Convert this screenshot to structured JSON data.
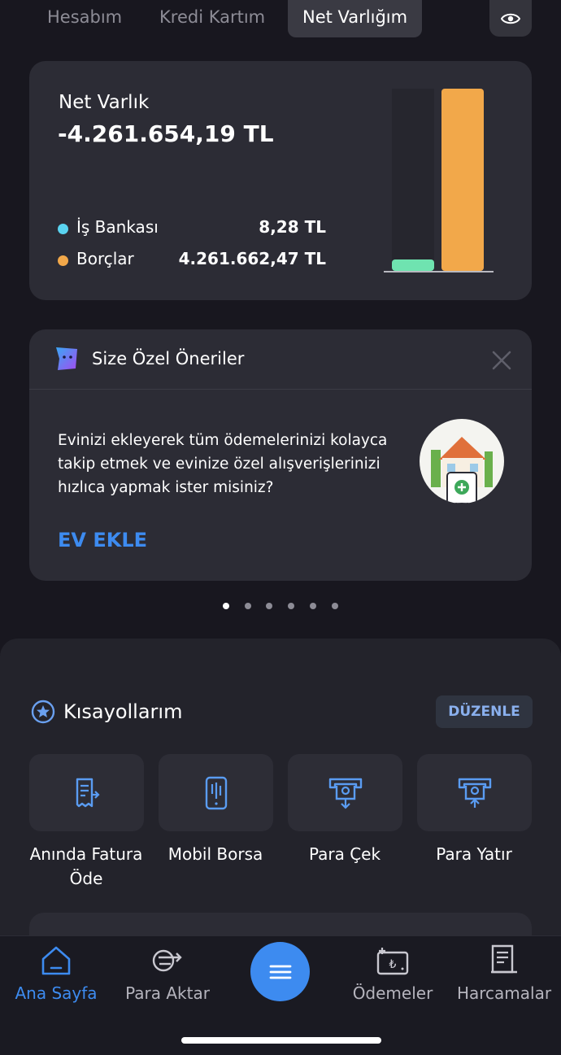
{
  "tabs": [
    {
      "label": "Hesabım"
    },
    {
      "label": "Kredi Kartım"
    },
    {
      "label": "Net Varlığım"
    }
  ],
  "net_varlik": {
    "title": "Net Varlık",
    "value": "-4.261.654,19 TL",
    "legend": [
      {
        "label": "İş Bankası",
        "value": "8,28 TL",
        "color": "#5ad3f0"
      },
      {
        "label": "Borçlar",
        "value": "4.261.662,47 TL",
        "color": "#f2a84a"
      }
    ],
    "chart_data": {
      "type": "bar",
      "categories": [
        "İş Bankası",
        "Borçlar"
      ],
      "values": [
        8.28,
        4261662.47
      ]
    }
  },
  "oneri": {
    "title": "Size Özel Öneriler",
    "text": "Evinizi ekleyerek tüm ödemelerinizi kolayca takip etmek ve evinize özel alışverişlerinizi hızlıca yapmak ister misiniz?",
    "action": "EV EKLE",
    "page_count": 6,
    "active_page": 1
  },
  "kisayollar": {
    "title": "Kısayollarım",
    "edit_label": "DÜZENLE",
    "items": [
      {
        "label": "Anında Fatura Öde",
        "icon": "receipt-icon"
      },
      {
        "label": "Mobil Borsa",
        "icon": "phone-chart-icon"
      },
      {
        "label": "Para Çek",
        "icon": "atm-withdraw-icon"
      },
      {
        "label": "Para Yatır",
        "icon": "atm-deposit-icon"
      }
    ]
  },
  "nav": {
    "items": [
      {
        "label": "Ana Sayfa",
        "icon": "home-icon",
        "active": true
      },
      {
        "label": "Para Aktar",
        "icon": "transfer-icon"
      },
      {
        "label": "Ödemeler",
        "icon": "payments-icon"
      },
      {
        "label": "Harcamalar",
        "icon": "expenses-icon"
      }
    ]
  },
  "colors": {
    "accent": "#3d8bf0",
    "background": "#18171f",
    "card": "#2c2c35"
  }
}
